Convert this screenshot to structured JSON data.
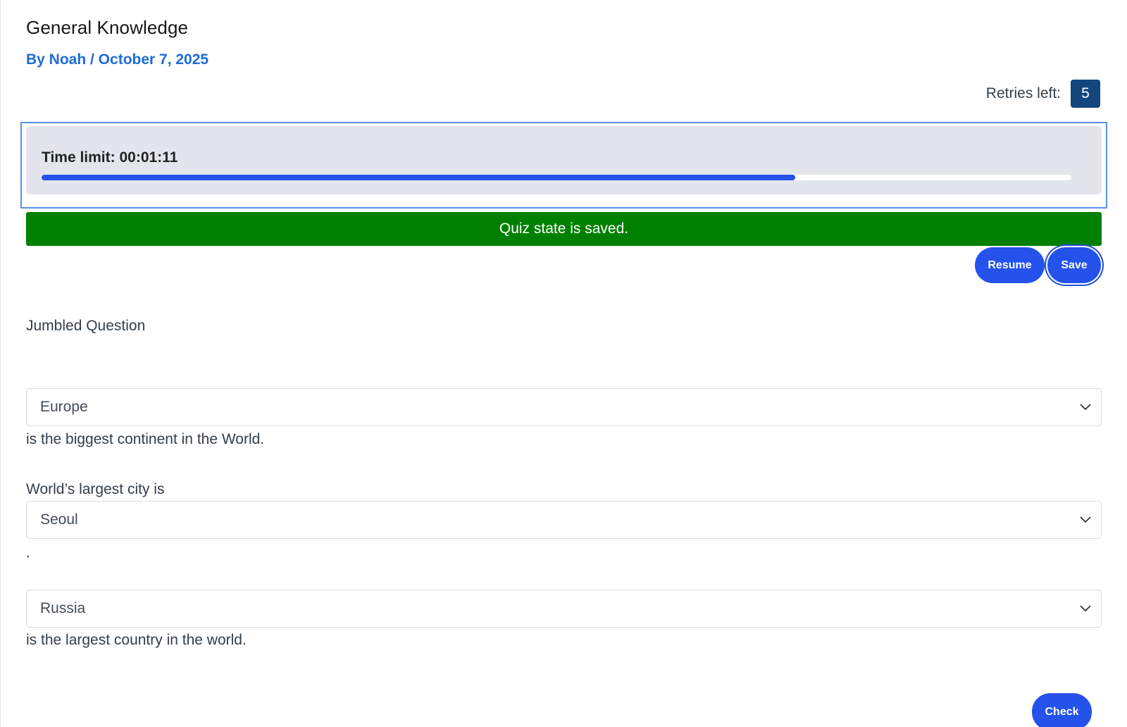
{
  "quiz": {
    "title": "General Knowledge",
    "byline": "By Noah / October 7, 2025"
  },
  "retries": {
    "label": "Retries left:",
    "count": "5"
  },
  "timer": {
    "label": "Time limit: 00:01:11",
    "progress_percent": 73.2,
    "fill_color": "#2452eb"
  },
  "status": {
    "message": "Quiz state is saved.",
    "color": "#008000"
  },
  "actions": {
    "resume_label": "Resume",
    "save_label": "Save",
    "check_label": "Check",
    "accent_color": "#2452eb"
  },
  "question": {
    "title": "Jumbled Question",
    "items": [
      {
        "prefix": "",
        "selected": "Europe",
        "suffix": "is the biggest continent in the World."
      },
      {
        "prefix": "World’s largest city is",
        "selected": "Seoul",
        "suffix": "."
      },
      {
        "prefix": "",
        "selected": "Russia",
        "suffix": "is the largest country in the world."
      }
    ]
  },
  "icons": {
    "select_arrow": "chevron-down-icon"
  }
}
